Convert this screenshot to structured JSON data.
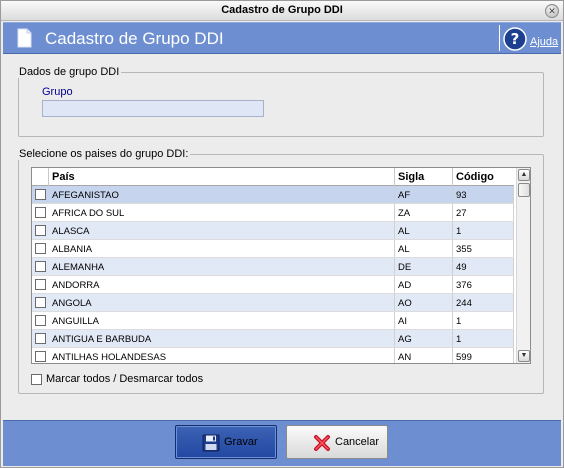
{
  "window": {
    "title": "Cadastro de Grupo DDI"
  },
  "header": {
    "title": "Cadastro de Grupo DDI",
    "help_label": "Ajuda"
  },
  "dados": {
    "legend": "Dados de grupo DDI",
    "grupo_label": "Grupo",
    "grupo_value": ""
  },
  "paises": {
    "legend": "Selecione os paises do grupo DDI:",
    "columns": {
      "pais": "País",
      "sigla": "Sigla",
      "codigo": "Código"
    },
    "rows": [
      {
        "pais": "AFEGANISTAO",
        "sigla": "AF",
        "codigo": "93"
      },
      {
        "pais": "AFRICA DO SUL",
        "sigla": "ZA",
        "codigo": "27"
      },
      {
        "pais": "ALASCA",
        "sigla": "AL",
        "codigo": "1"
      },
      {
        "pais": "ALBANIA",
        "sigla": "AL",
        "codigo": "355"
      },
      {
        "pais": "ALEMANHA",
        "sigla": "DE",
        "codigo": "49"
      },
      {
        "pais": "ANDORRA",
        "sigla": "AD",
        "codigo": "376"
      },
      {
        "pais": "ANGOLA",
        "sigla": "AO",
        "codigo": "244"
      },
      {
        "pais": "ANGUILLA",
        "sigla": "AI",
        "codigo": "1"
      },
      {
        "pais": "ANTIGUA E BARBUDA",
        "sigla": "AG",
        "codigo": "1"
      },
      {
        "pais": "ANTILHAS HOLANDESAS",
        "sigla": "AN",
        "codigo": "599"
      }
    ],
    "select_all_label": "Marcar todos / Desmarcar todos"
  },
  "footer": {
    "save_label": "Gravar",
    "cancel_label": "Cancelar"
  },
  "colors": {
    "header_blue": "#6d8fd1",
    "row_alt": "#e2e9f6",
    "row_selected": "#c6d4ee",
    "field_label": "#00008b"
  },
  "icons": {
    "doc": "document-icon",
    "help": "help-icon",
    "save": "floppy-disk-icon",
    "cancel": "red-x-icon"
  }
}
